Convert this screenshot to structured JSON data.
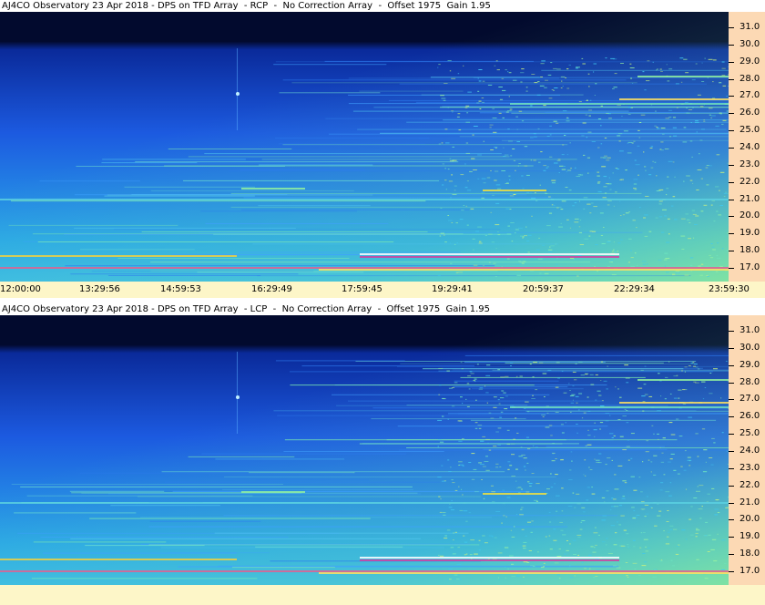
{
  "panels": [
    {
      "title": "AJ4CO Observatory 23 Apr 2018 - DPS on TFD Array  - RCP  -  No Correction Array  -  Offset 1975  Gain 1.95",
      "polarization": "RCP"
    },
    {
      "title": "AJ4CO Observatory 23 Apr 2018 - DPS on TFD Array  - LCP  -  No Correction Array  -  Offset 1975  Gain 1.95",
      "polarization": "LCP"
    }
  ],
  "y_axis_ticks": [
    "31.0",
    "30.0",
    "29.0",
    "28.0",
    "27.0",
    "26.0",
    "25.0",
    "24.0",
    "23.0",
    "22.0",
    "21.0",
    "20.0",
    "19.0",
    "18.0",
    "17.0"
  ],
  "x_axis_ticks": [
    "12:00:00",
    "13:29:56",
    "14:59:53",
    "16:29:49",
    "17:59:45",
    "19:29:41",
    "20:59:37",
    "22:29:34",
    "23:59:30"
  ],
  "colors": {
    "spectrogram_top": "#020a2e",
    "spectrogram_mid": "#1c5ae0",
    "spectrogram_low": "#29a7e8",
    "noise_high": "#7fe6a0",
    "y_axis_bg": "#fcd9b4",
    "x_axis_bg": "#fdf6c8"
  }
}
